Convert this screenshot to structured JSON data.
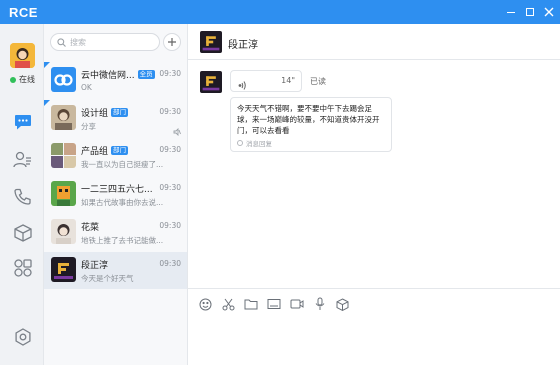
{
  "app": {
    "title": "RCE"
  },
  "user": {
    "status_text": "在线",
    "status_color": "#31c05a"
  },
  "search": {
    "placeholder": "搜索"
  },
  "conversations": [
    {
      "name": "云中微信网...",
      "badge": "全员",
      "time": "09:30",
      "preview": "OK",
      "pinned": true,
      "muted": false,
      "active": false
    },
    {
      "name": "设计组",
      "badge": "部门",
      "time": "09:30",
      "preview": "分享",
      "pinned": true,
      "muted": true,
      "active": false
    },
    {
      "name": "产品组",
      "badge": "部门",
      "time": "09:30",
      "preview": "我一直以为自己挺瘦了...",
      "pinned": false,
      "muted": false,
      "active": false
    },
    {
      "name": "一二三四五六七...",
      "badge": "",
      "time": "09:30",
      "preview": "如果古代故事由你去说...",
      "pinned": false,
      "muted": false,
      "active": false
    },
    {
      "name": "花菜",
      "badge": "",
      "time": "09:30",
      "preview": "地铁上推了去书记能做...",
      "pinned": false,
      "muted": false,
      "active": false
    },
    {
      "name": "段正淳",
      "badge": "",
      "time": "09:30",
      "preview": "今天是个好天气",
      "pinned": false,
      "muted": false,
      "active": true
    }
  ],
  "chat": {
    "title": "段正淳",
    "voice_duration": "14\"",
    "read_status": "已读",
    "text_message": "今天天气不错啊，要不要中午下去踢会足球，来一场巅峰的较量，不知道贵体开没开门，可以去看看",
    "receipt_text": "消息回复"
  },
  "composer_tools": [
    "emoji-icon",
    "scissors-icon",
    "folder-icon",
    "image-icon",
    "video-icon",
    "microphone-icon",
    "package-icon"
  ],
  "colors": {
    "accent": "#2e8ff0",
    "titlebar": "#2e8ff0",
    "online": "#31c05a"
  }
}
